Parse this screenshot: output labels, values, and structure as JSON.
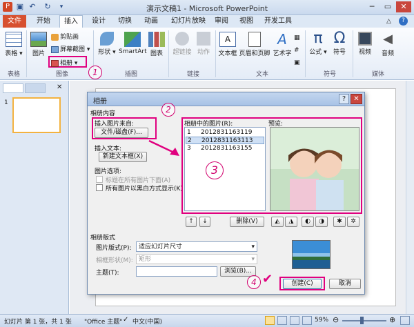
{
  "window": {
    "title": "演示文稿1 - Microsoft PowerPoint",
    "quick_access": [
      "save",
      "undo",
      "redo",
      "customize"
    ]
  },
  "tabs": [
    {
      "label": "文件"
    },
    {
      "label": "开始"
    },
    {
      "label": "插入"
    },
    {
      "label": "设计"
    },
    {
      "label": "切换"
    },
    {
      "label": "动画"
    },
    {
      "label": "幻灯片放映"
    },
    {
      "label": "审阅"
    },
    {
      "label": "视图"
    },
    {
      "label": "开发工具"
    }
  ],
  "ribbon": {
    "table": {
      "label": "表格",
      "group": "表格"
    },
    "picture": {
      "label": "图片"
    },
    "clipart": {
      "label": "剪贴画"
    },
    "screenshot": {
      "label": "屏幕截图"
    },
    "album": {
      "label": "相册"
    },
    "images_group": "图像",
    "shapes": {
      "label": "形状"
    },
    "smartart": {
      "label": "SmartArt"
    },
    "chart": {
      "label": "图表"
    },
    "illustrations_group": "插图",
    "hyperlink": {
      "label": "超链接"
    },
    "action": {
      "label": "动作"
    },
    "links_group": "链接",
    "textbox": {
      "label": "文本框"
    },
    "header_footer": {
      "label": "页眉和页脚"
    },
    "wordart": {
      "label": "艺术字"
    },
    "text_group": "文本",
    "equation": {
      "label": "公式"
    },
    "symbol": {
      "label": "符号"
    },
    "symbols_group": "符号",
    "video": {
      "label": "视频"
    },
    "audio": {
      "label": "音频"
    },
    "media_group": "媒体"
  },
  "slide_panel": {
    "slide_number": "1"
  },
  "dialog": {
    "title": "相册",
    "section_content": "相册内容",
    "insert_from": "插入图片来自:",
    "file_disk_button": "文件/磁盘(F)...",
    "insert_text": "插入文本:",
    "new_textbox_button": "新建文本框(X)",
    "picture_options": "图片选项:",
    "caption_below": "标题在所有图片下面(A)",
    "all_black_white": "所有图片以黑白方式显示(K)",
    "pictures_in_album": "相册中的图片(R):",
    "preview": "预览:",
    "pictures": [
      {
        "num": "1",
        "name": "2012831163119"
      },
      {
        "num": "2",
        "name": "2012831163113"
      },
      {
        "num": "3",
        "name": "2012831163155"
      }
    ],
    "move_up": "↑",
    "move_down": "↓",
    "remove_button": "删除(V)",
    "section_layout": "相册版式",
    "picture_layout_label": "图片版式(P):",
    "picture_layout_value": "适应幻灯片尺寸",
    "frame_shape_label": "相框形状(M):",
    "frame_shape_value": "矩形",
    "theme_label": "主题(T):",
    "theme_value": "",
    "browse_button": "浏览(B)...",
    "create_button": "创建(C)",
    "cancel_button": "取消"
  },
  "annotations": {
    "a1": "1",
    "a2": "2",
    "a3": "3",
    "a4": "4"
  },
  "statusbar": {
    "slide_info": "幻灯片 第 1 张，共 1 张",
    "theme": "\"Office 主题\"",
    "language": "中文(中国)",
    "zoom": "59%"
  },
  "colors": {
    "accent_pink": "#e0007f",
    "file_tab": "#d7502f"
  }
}
